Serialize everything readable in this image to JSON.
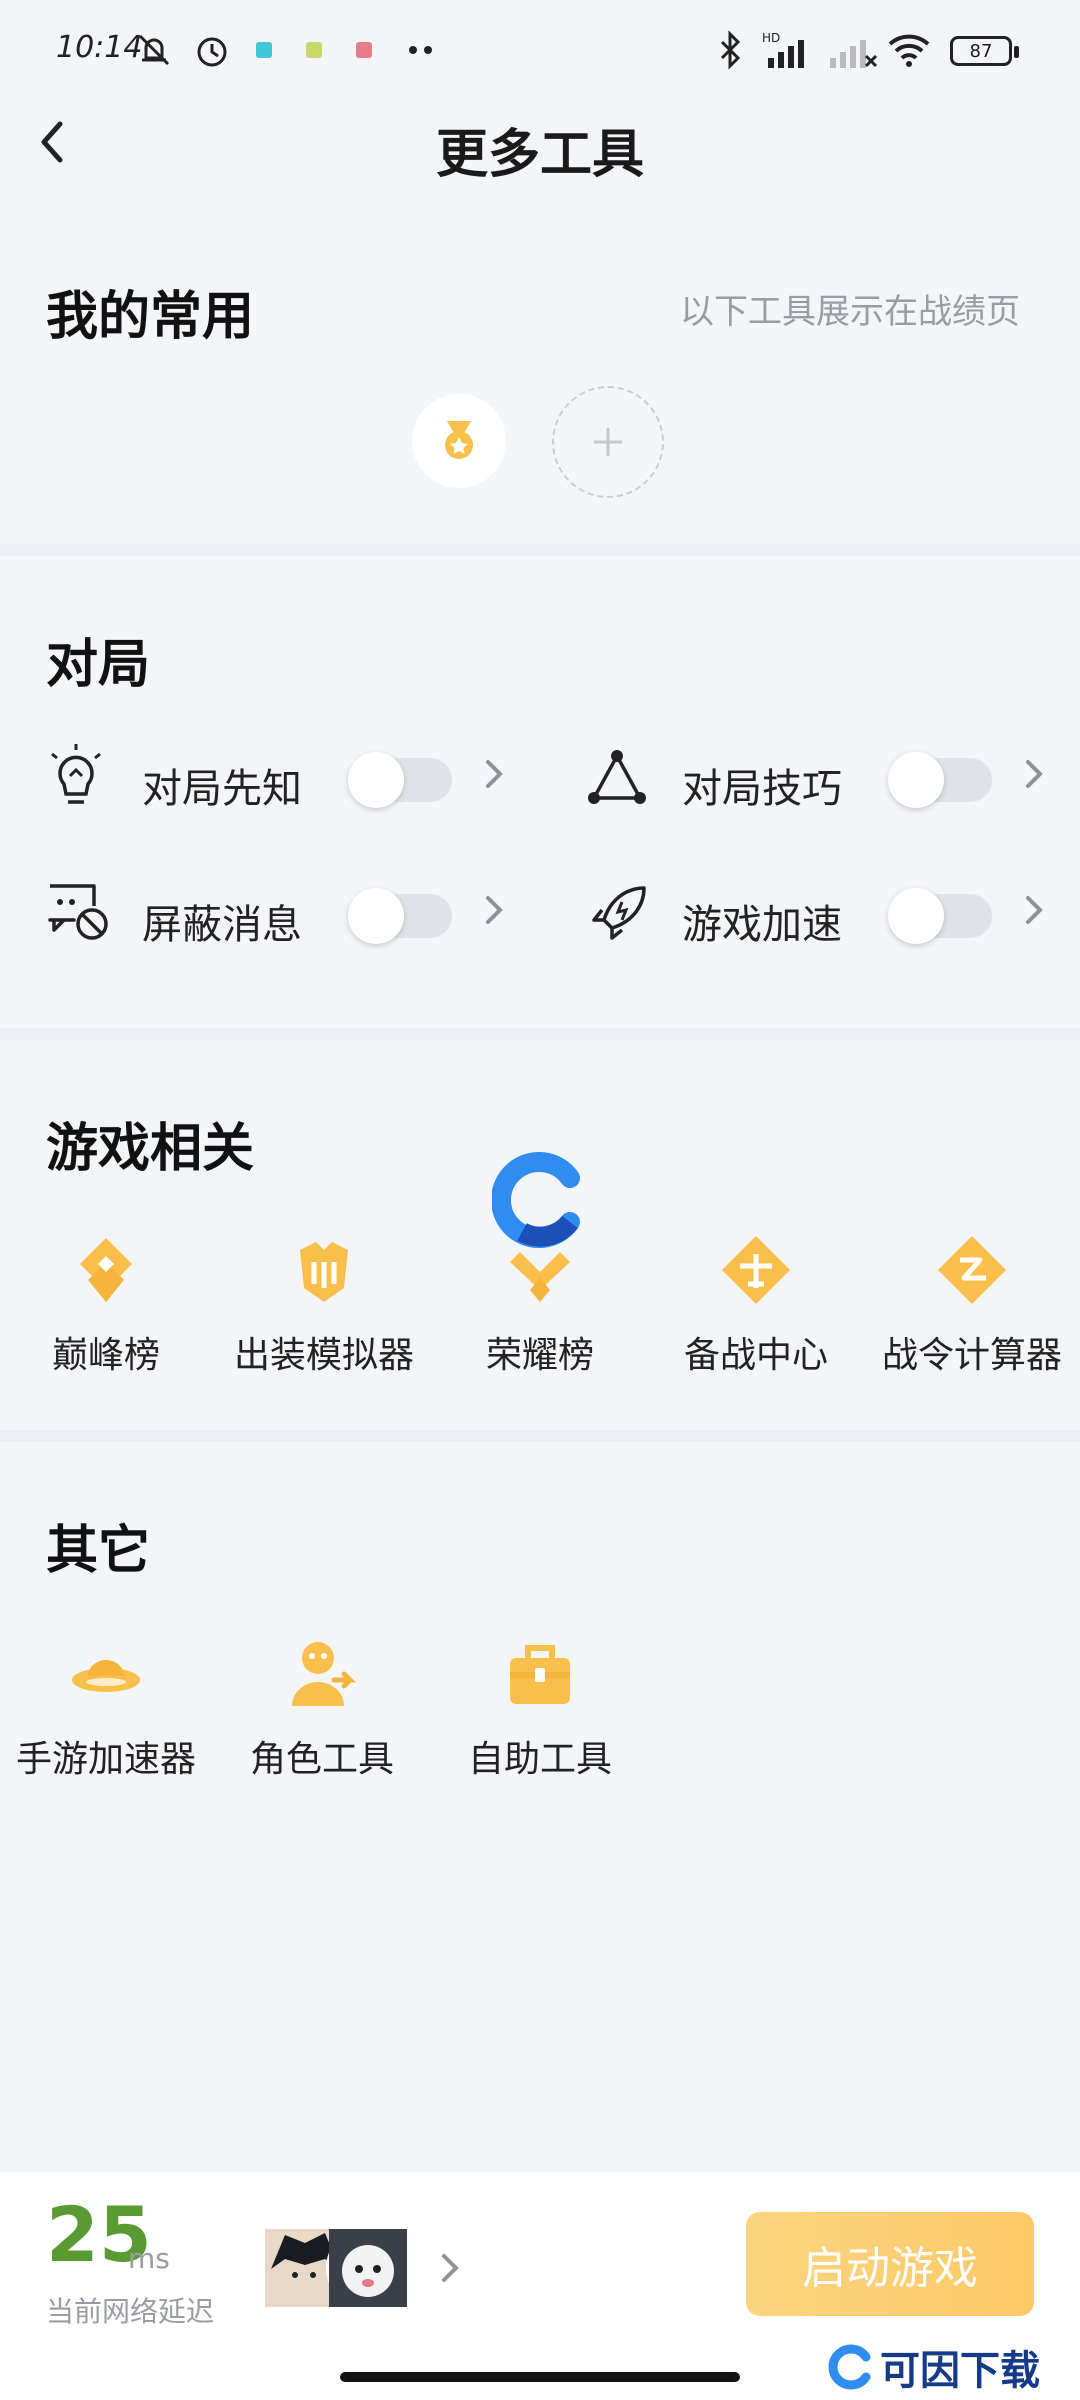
{
  "status_bar": {
    "time": "10:14",
    "battery": "87",
    "signal_label": "HD"
  },
  "header": {
    "title": "更多工具"
  },
  "favorites": {
    "title": "我的常用",
    "hint": "以下工具展示在战绩页"
  },
  "match": {
    "title": "对局",
    "tools": [
      {
        "label": "对局先知",
        "icon": "lightbulb-icon",
        "enabled": false
      },
      {
        "label": "对局技巧",
        "icon": "triangle-nodes-icon",
        "enabled": false
      },
      {
        "label": "屏蔽消息",
        "icon": "message-block-icon",
        "enabled": false
      },
      {
        "label": "游戏加速",
        "icon": "rocket-icon",
        "enabled": false
      }
    ]
  },
  "game": {
    "title": "游戏相关",
    "items": [
      {
        "label": "巅峰榜",
        "icon": "peak-rank-icon"
      },
      {
        "label": "出装模拟器",
        "icon": "equipment-simulator-icon"
      },
      {
        "label": "荣耀榜",
        "icon": "glory-rank-icon"
      },
      {
        "label": "备战中心",
        "icon": "prep-center-icon"
      },
      {
        "label": "战令计算器",
        "icon": "pass-calculator-icon"
      }
    ]
  },
  "other": {
    "title": "其它",
    "items": [
      {
        "label": "手游加速器",
        "icon": "ufo-accelerator-icon"
      },
      {
        "label": "角色工具",
        "icon": "role-tool-icon"
      },
      {
        "label": "自助工具",
        "icon": "toolbox-icon"
      }
    ]
  },
  "bottom_bar": {
    "latency_value": "25",
    "latency_unit": "ms",
    "latency_label": "当前网络延迟",
    "start_button": "启动游戏"
  },
  "watermark": {
    "text": "可因下载"
  },
  "colors": {
    "accent": "#f8c04a",
    "latency": "#5a9a33",
    "button": "#fcc965",
    "watermark": "#163a8a"
  }
}
